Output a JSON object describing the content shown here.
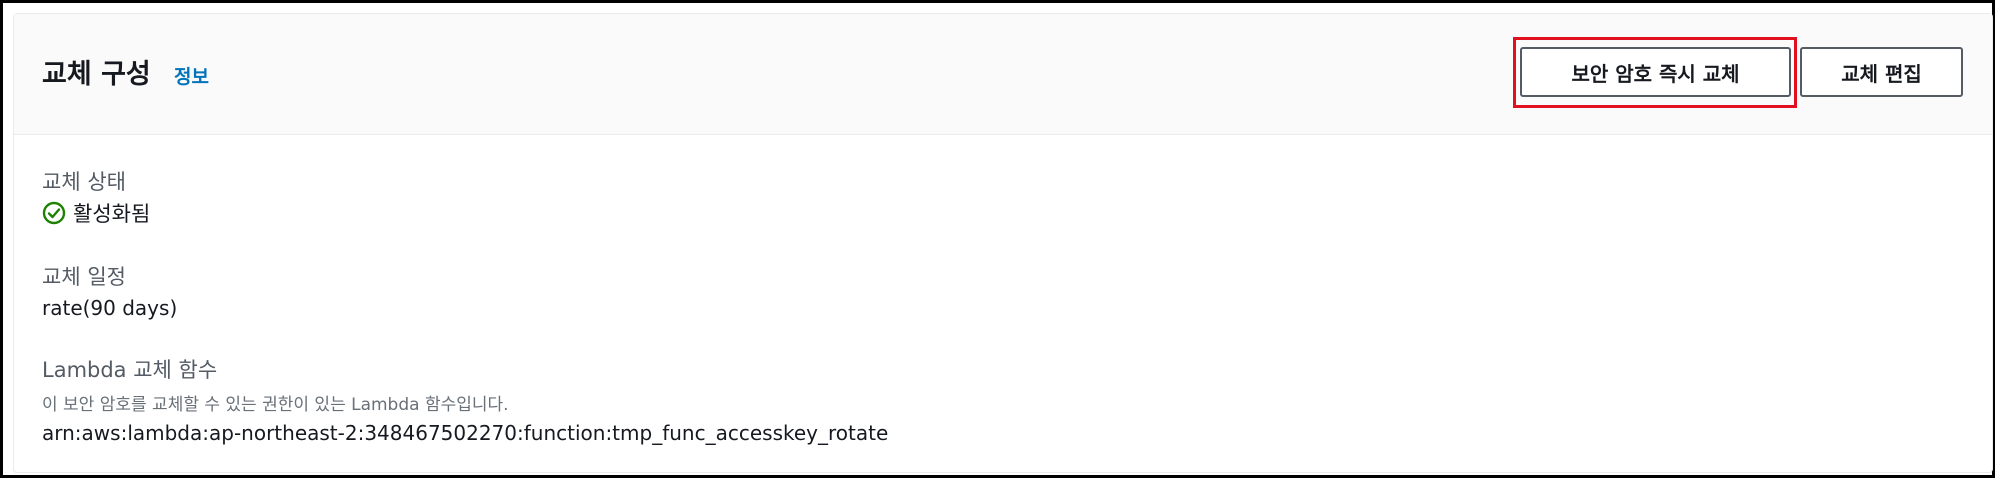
{
  "header": {
    "title": "교체 구성",
    "info_link": "정보"
  },
  "actions": {
    "rotate_now_label": "보안 암호 즉시 교체",
    "edit_rotation_label": "교체 편집"
  },
  "fields": {
    "rotation_status": {
      "label": "교체 상태",
      "value": "활성화됨",
      "icon": "check-circle-icon",
      "color": "#1d8102"
    },
    "rotation_schedule": {
      "label": "교체 일정",
      "value": "rate(90 days)"
    },
    "lambda_function": {
      "label": "Lambda 교체 함수",
      "description": "이 보안 암호를 교체할 수 있는 권한이 있는 Lambda 함수입니다.",
      "value": "arn:aws:lambda:ap-northeast-2:348467502270:function:tmp_func_accesskey_rotate"
    }
  },
  "colors": {
    "link": "#0073bb",
    "highlight": "#e0101e",
    "success": "#1d8102"
  }
}
